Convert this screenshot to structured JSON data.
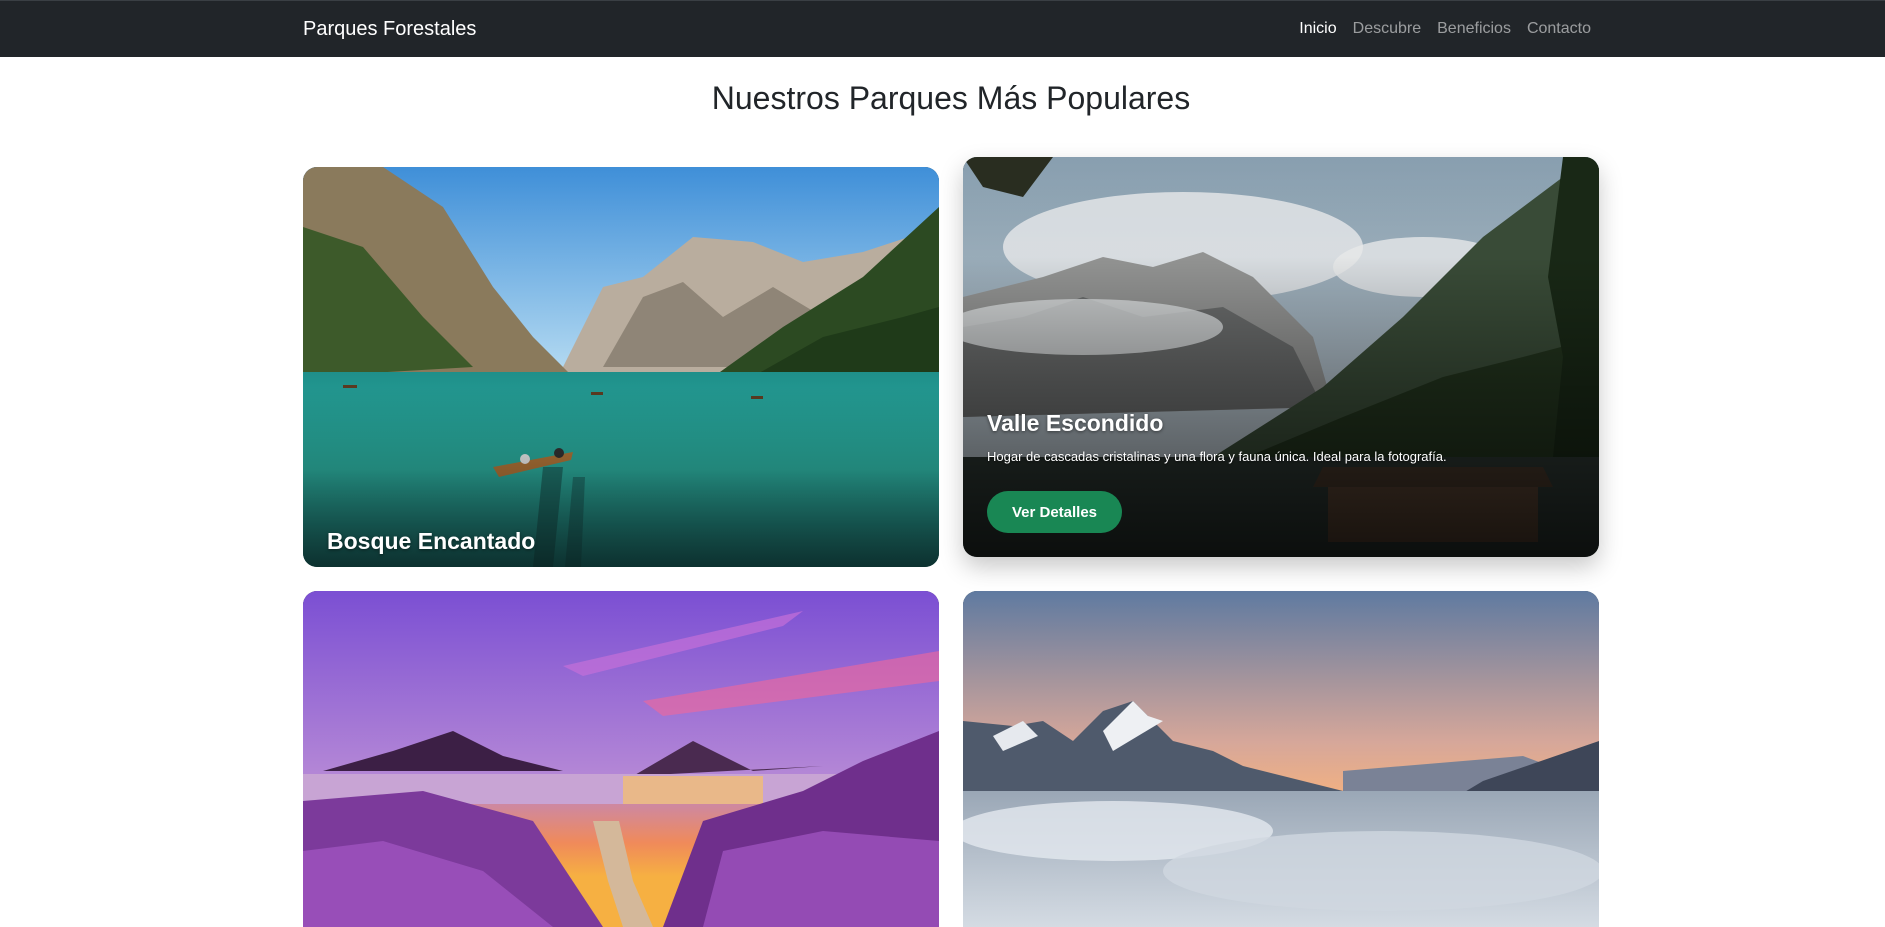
{
  "navbar": {
    "brand": "Parques Forestales",
    "links": [
      "Inicio",
      "Descubre",
      "Beneficios",
      "Contacto"
    ],
    "active_index": 0
  },
  "main": {
    "title": "Nuestros Parques Más Populares",
    "cards": [
      {
        "title": "Bosque Encantado"
      },
      {
        "title": "Valle Escondido",
        "text": "Hogar de cascadas cristalinas y una flora y fauna única. Ideal para la fotografía.",
        "button": "Ver Detalles"
      },
      {
        "title": ""
      },
      {
        "title": ""
      }
    ]
  },
  "colors": {
    "navbar_bg": "#212529",
    "button_bg": "#198754"
  }
}
